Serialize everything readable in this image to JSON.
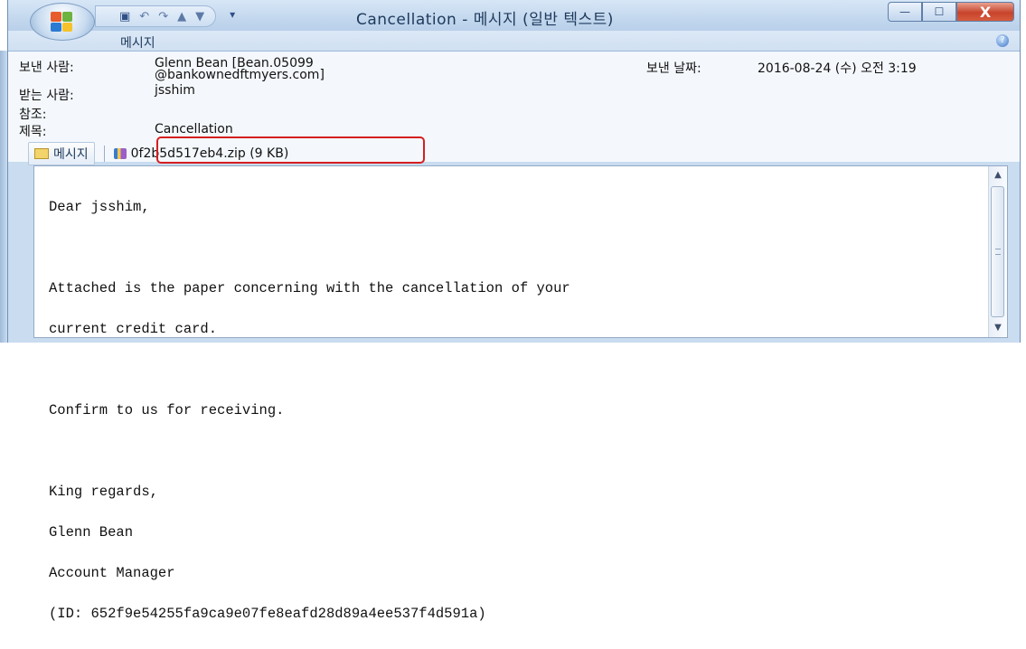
{
  "window": {
    "title": "Cancellation - 메시지 (일반 텍스트)",
    "minimize_label": "—",
    "maximize_label": "☐",
    "close_label": "X"
  },
  "quick_access": {
    "save_icon": "save-icon",
    "undo_icon": "undo-icon",
    "redo_icon": "redo-icon",
    "up_icon": "up-arrow-icon",
    "down_icon": "down-arrow-icon",
    "customize_icon": "dropdown-icon"
  },
  "ribbon": {
    "tab_label": "메시지",
    "help_icon": "help-icon"
  },
  "header": {
    "from_label": "보낸 사람:",
    "from_value_line1": "Glenn Bean [Bean.05099",
    "from_value_line2": "@bankownedftmyers.com]",
    "to_label": "받는 사람:",
    "to_value": "jsshim",
    "cc_label": "참조:",
    "subject_label": "제목:",
    "subject_value": "Cancellation",
    "sent_label": "보낸 날짜:",
    "sent_value": "2016-08-24 (수) 오전 3:19"
  },
  "attachments": {
    "message_tab_label": "메시지",
    "file_label": "0f2b5d517eb4.zip (9 KB)"
  },
  "body": {
    "lines": [
      "Dear jsshim,",
      "",
      "Attached is the paper concerning with the cancellation of your",
      "current credit card.",
      "",
      "Confirm to us for receiving.",
      "",
      "King regards,",
      "Glenn Bean",
      "Account Manager",
      "(ID: 652f9e54255fa9ca9e07fe8eafd28d89a4ee537f4d591a)"
    ]
  },
  "colors": {
    "highlight": "#d51f1f",
    "titlebar": "#c3d8ee",
    "close_button": "#c8442c"
  }
}
